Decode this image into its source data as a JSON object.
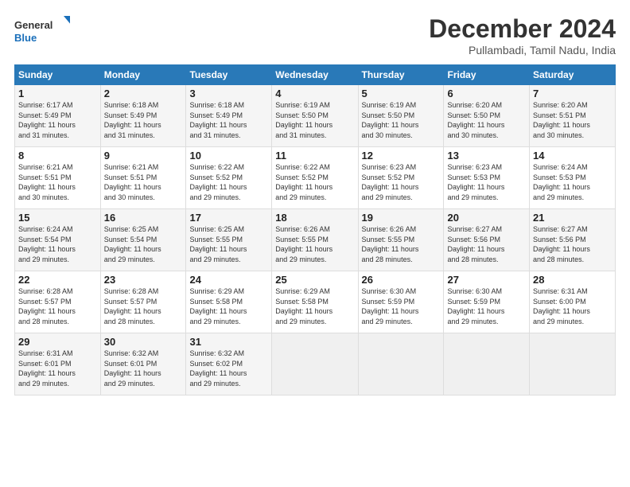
{
  "header": {
    "logo_line1": "General",
    "logo_line2": "Blue",
    "month_title": "December 2024",
    "location": "Pullambadi, Tamil Nadu, India"
  },
  "weekdays": [
    "Sunday",
    "Monday",
    "Tuesday",
    "Wednesday",
    "Thursday",
    "Friday",
    "Saturday"
  ],
  "weeks": [
    [
      {
        "day": "1",
        "info": "Sunrise: 6:17 AM\nSunset: 5:49 PM\nDaylight: 11 hours\nand 31 minutes."
      },
      {
        "day": "2",
        "info": "Sunrise: 6:18 AM\nSunset: 5:49 PM\nDaylight: 11 hours\nand 31 minutes."
      },
      {
        "day": "3",
        "info": "Sunrise: 6:18 AM\nSunset: 5:49 PM\nDaylight: 11 hours\nand 31 minutes."
      },
      {
        "day": "4",
        "info": "Sunrise: 6:19 AM\nSunset: 5:50 PM\nDaylight: 11 hours\nand 31 minutes."
      },
      {
        "day": "5",
        "info": "Sunrise: 6:19 AM\nSunset: 5:50 PM\nDaylight: 11 hours\nand 30 minutes."
      },
      {
        "day": "6",
        "info": "Sunrise: 6:20 AM\nSunset: 5:50 PM\nDaylight: 11 hours\nand 30 minutes."
      },
      {
        "day": "7",
        "info": "Sunrise: 6:20 AM\nSunset: 5:51 PM\nDaylight: 11 hours\nand 30 minutes."
      }
    ],
    [
      {
        "day": "8",
        "info": "Sunrise: 6:21 AM\nSunset: 5:51 PM\nDaylight: 11 hours\nand 30 minutes."
      },
      {
        "day": "9",
        "info": "Sunrise: 6:21 AM\nSunset: 5:51 PM\nDaylight: 11 hours\nand 30 minutes."
      },
      {
        "day": "10",
        "info": "Sunrise: 6:22 AM\nSunset: 5:52 PM\nDaylight: 11 hours\nand 29 minutes."
      },
      {
        "day": "11",
        "info": "Sunrise: 6:22 AM\nSunset: 5:52 PM\nDaylight: 11 hours\nand 29 minutes."
      },
      {
        "day": "12",
        "info": "Sunrise: 6:23 AM\nSunset: 5:52 PM\nDaylight: 11 hours\nand 29 minutes."
      },
      {
        "day": "13",
        "info": "Sunrise: 6:23 AM\nSunset: 5:53 PM\nDaylight: 11 hours\nand 29 minutes."
      },
      {
        "day": "14",
        "info": "Sunrise: 6:24 AM\nSunset: 5:53 PM\nDaylight: 11 hours\nand 29 minutes."
      }
    ],
    [
      {
        "day": "15",
        "info": "Sunrise: 6:24 AM\nSunset: 5:54 PM\nDaylight: 11 hours\nand 29 minutes."
      },
      {
        "day": "16",
        "info": "Sunrise: 6:25 AM\nSunset: 5:54 PM\nDaylight: 11 hours\nand 29 minutes."
      },
      {
        "day": "17",
        "info": "Sunrise: 6:25 AM\nSunset: 5:55 PM\nDaylight: 11 hours\nand 29 minutes."
      },
      {
        "day": "18",
        "info": "Sunrise: 6:26 AM\nSunset: 5:55 PM\nDaylight: 11 hours\nand 29 minutes."
      },
      {
        "day": "19",
        "info": "Sunrise: 6:26 AM\nSunset: 5:55 PM\nDaylight: 11 hours\nand 28 minutes."
      },
      {
        "day": "20",
        "info": "Sunrise: 6:27 AM\nSunset: 5:56 PM\nDaylight: 11 hours\nand 28 minutes."
      },
      {
        "day": "21",
        "info": "Sunrise: 6:27 AM\nSunset: 5:56 PM\nDaylight: 11 hours\nand 28 minutes."
      }
    ],
    [
      {
        "day": "22",
        "info": "Sunrise: 6:28 AM\nSunset: 5:57 PM\nDaylight: 11 hours\nand 28 minutes."
      },
      {
        "day": "23",
        "info": "Sunrise: 6:28 AM\nSunset: 5:57 PM\nDaylight: 11 hours\nand 28 minutes."
      },
      {
        "day": "24",
        "info": "Sunrise: 6:29 AM\nSunset: 5:58 PM\nDaylight: 11 hours\nand 29 minutes."
      },
      {
        "day": "25",
        "info": "Sunrise: 6:29 AM\nSunset: 5:58 PM\nDaylight: 11 hours\nand 29 minutes."
      },
      {
        "day": "26",
        "info": "Sunrise: 6:30 AM\nSunset: 5:59 PM\nDaylight: 11 hours\nand 29 minutes."
      },
      {
        "day": "27",
        "info": "Sunrise: 6:30 AM\nSunset: 5:59 PM\nDaylight: 11 hours\nand 29 minutes."
      },
      {
        "day": "28",
        "info": "Sunrise: 6:31 AM\nSunset: 6:00 PM\nDaylight: 11 hours\nand 29 minutes."
      }
    ],
    [
      {
        "day": "29",
        "info": "Sunrise: 6:31 AM\nSunset: 6:01 PM\nDaylight: 11 hours\nand 29 minutes."
      },
      {
        "day": "30",
        "info": "Sunrise: 6:32 AM\nSunset: 6:01 PM\nDaylight: 11 hours\nand 29 minutes."
      },
      {
        "day": "31",
        "info": "Sunrise: 6:32 AM\nSunset: 6:02 PM\nDaylight: 11 hours\nand 29 minutes."
      },
      null,
      null,
      null,
      null
    ]
  ]
}
